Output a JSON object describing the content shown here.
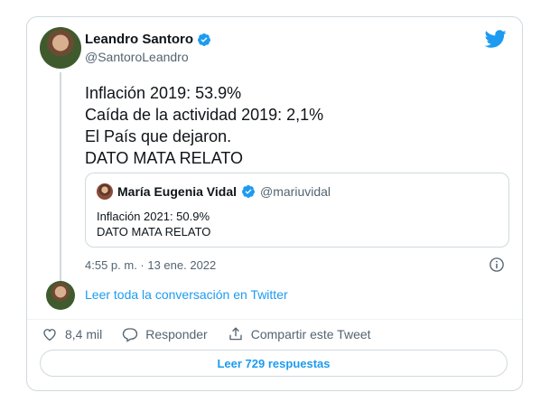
{
  "author": {
    "name": "Leandro Santoro",
    "handle": "@SantoroLeandro"
  },
  "tweet": {
    "lines": [
      "Inflación 2019: 53.9%",
      "Caída de la actividad 2019: 2,1%",
      "El País que dejaron.",
      "DATO MATA RELATO"
    ],
    "timestamp": "4:55 p. m. · 13 ene. 2022"
  },
  "quoted": {
    "name": "María Eugenia Vidal",
    "handle": "@mariuvidal",
    "lines": [
      "Inflación 2021: 50.9%",
      "DATO MATA RELATO"
    ]
  },
  "thread": {
    "read_conversation": "Leer toda la conversación en Twitter"
  },
  "actions": {
    "like_count": "8,4 mil",
    "reply_label": "Responder",
    "share_label": "Compartir este Tweet"
  },
  "replies_button": "Leer 729 respuestas",
  "icons": {
    "verified": "verified-badge-icon",
    "brand": "twitter-bird-icon",
    "info": "info-icon",
    "like": "heart-icon",
    "reply": "reply-bubble-icon",
    "share": "share-icon"
  },
  "colors": {
    "accent": "#1d9bf0",
    "secondary_text": "#536471",
    "border": "#cfd9de"
  }
}
